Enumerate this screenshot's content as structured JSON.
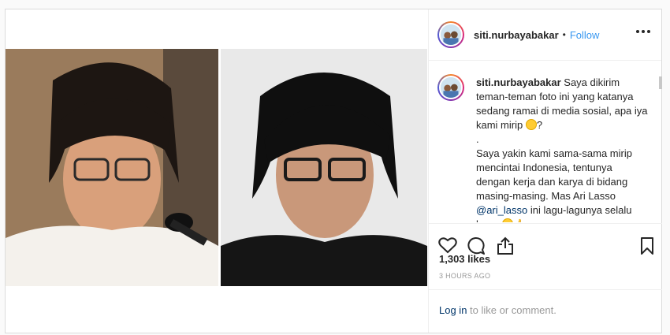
{
  "post": {
    "username": "siti.nurbayabakar",
    "separator": "•",
    "follow_label": "Follow",
    "more_icon": "more-horizontal-icon",
    "caption": {
      "username": "siti.nurbayabakar",
      "line1": "Saya dikirim teman-teman foto ini yang katanya sedang ramai di media sosial, apa iya kami mirip",
      "line1_end": "?",
      "dot": ".",
      "line2": "Saya yakin kami sama-sama mirip mencintai Indonesia, tentunya dengan kerja dan karya di bidang masing-masing. Mas Ari Lasso",
      "mention": "@ari_lasso",
      "line3": "ini lagu-lagunya selalu keren"
    },
    "likes": "1,303 likes",
    "time": "3 HOURS AGO",
    "login_label": "Log in",
    "login_suffix": "to like or comment.",
    "icons": {
      "like": "heart-icon",
      "comment": "comment-icon",
      "share": "share-icon",
      "save": "bookmark-icon",
      "tag": "user-tag-icon"
    }
  }
}
